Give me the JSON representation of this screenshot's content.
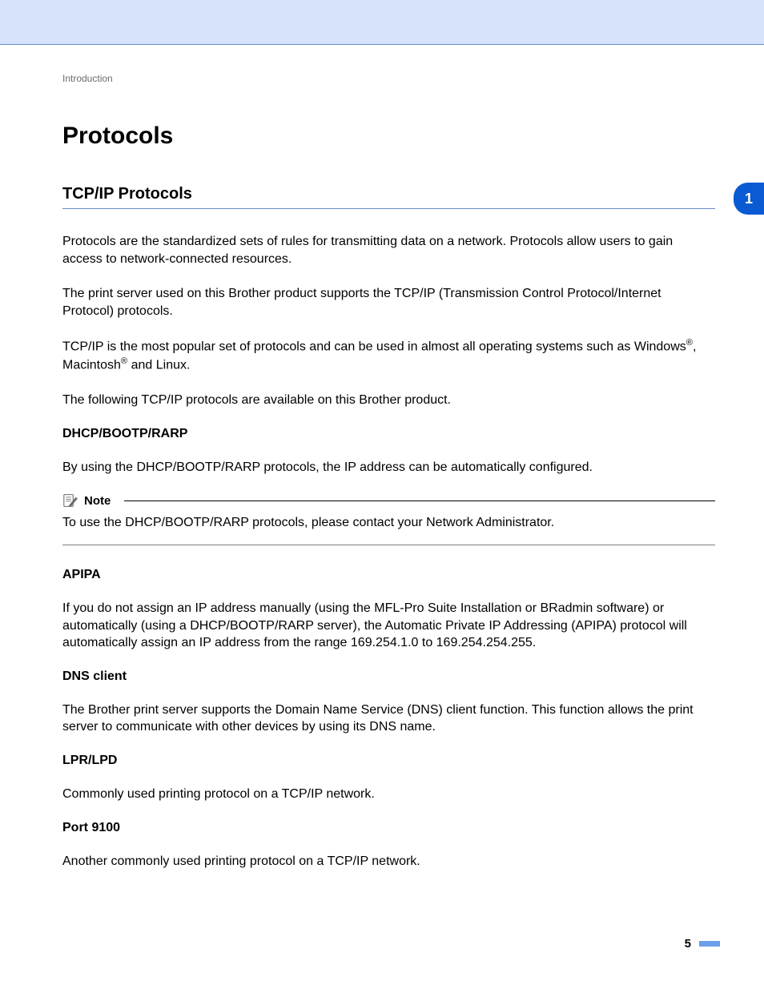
{
  "breadcrumb": "Introduction",
  "chapter_tab": "1",
  "page_number": "5",
  "h1": "Protocols",
  "h2": "TCP/IP Protocols",
  "intro_paragraphs": [
    "Protocols are the standardized sets of rules for transmitting data on a network. Protocols allow users to gain access to network-connected resources.",
    "The print server used on this Brother product supports the TCP/IP (Transmission Control Protocol/Internet Protocol) protocols.",
    "",
    "The following TCP/IP protocols are available on this Brother product."
  ],
  "os_sentence_prefix": "TCP/IP is the most popular set of protocols and can be used in almost all operating systems such as Windows",
  "os_sentence_mid": ", Macintosh",
  "os_sentence_suffix": " and Linux.",
  "reg_mark": "®",
  "sections": {
    "dhcp": {
      "heading": "DHCP/BOOTP/RARP",
      "body": "By using the DHCP/BOOTP/RARP protocols, the IP address can be automatically configured."
    },
    "note": {
      "label": "Note",
      "body": "To use the DHCP/BOOTP/RARP protocols, please contact your Network Administrator."
    },
    "apipa": {
      "heading": "APIPA",
      "body": "If you do not assign an IP address manually (using the MFL-Pro Suite Installation or BRadmin software) or automatically (using a DHCP/BOOTP/RARP server), the Automatic Private IP Addressing (APIPA) protocol will automatically assign an IP address from the range 169.254.1.0 to 169.254.254.255."
    },
    "dns": {
      "heading": "DNS client",
      "body": "The Brother print server supports the Domain Name Service (DNS) client function. This function allows the print server to communicate with other devices by using its DNS name."
    },
    "lpr": {
      "heading": "LPR/LPD",
      "body": "Commonly used printing protocol on a TCP/IP network."
    },
    "port9100": {
      "heading": "Port 9100",
      "body": "Another commonly used printing protocol on a TCP/IP network."
    }
  }
}
